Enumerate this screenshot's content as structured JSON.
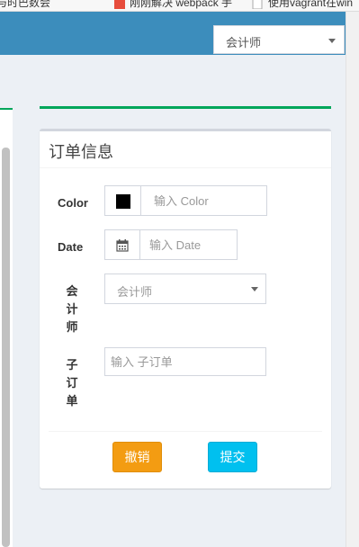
{
  "browser": {
    "bookmarks": [
      "与时巴数会",
      "刚刚解决 webpack 手",
      "使用vagrant在win"
    ]
  },
  "header": {
    "role_select": {
      "value": "会计师"
    }
  },
  "form": {
    "title": "订单信息",
    "color": {
      "label": "Color",
      "placeholder": "输入 Color",
      "swatch": "#000000"
    },
    "date": {
      "label": "Date",
      "placeholder": "输入 Date"
    },
    "accountant": {
      "label": "会计师",
      "selected": "会计师"
    },
    "suborder": {
      "label": "子订单",
      "placeholder": "输入 子订单"
    },
    "buttons": {
      "cancel": "撤销",
      "submit": "提交"
    }
  },
  "colors": {
    "header": "#3c8dbc",
    "success_line": "#00a65a",
    "cancel": "#f39c12",
    "submit": "#00c0ef"
  },
  "icons": [
    "calendar-icon",
    "chevron-down-icon",
    "page-favicon"
  ]
}
